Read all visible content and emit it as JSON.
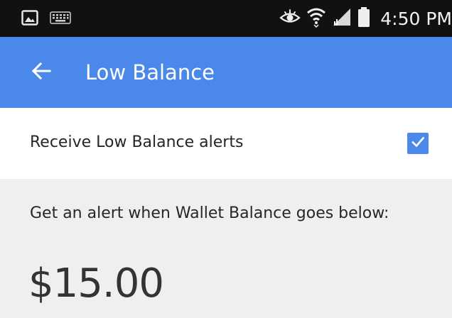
{
  "status_bar": {
    "time": "4:50 PM",
    "left_icons": [
      "image-icon",
      "keyboard-icon"
    ],
    "right_icons": [
      "eye-icon",
      "wifi-icon",
      "signal-icon",
      "battery-icon"
    ]
  },
  "app_bar": {
    "back_icon": "arrow-left-icon",
    "title": "Low Balance",
    "color": "#4a89e9"
  },
  "alerts": {
    "label": "Receive Low Balance alerts",
    "checked": true,
    "checkbox_color": "#4a89e9"
  },
  "threshold": {
    "description": "Get an alert when Wallet Balance goes below:",
    "amount": "$15.00"
  }
}
